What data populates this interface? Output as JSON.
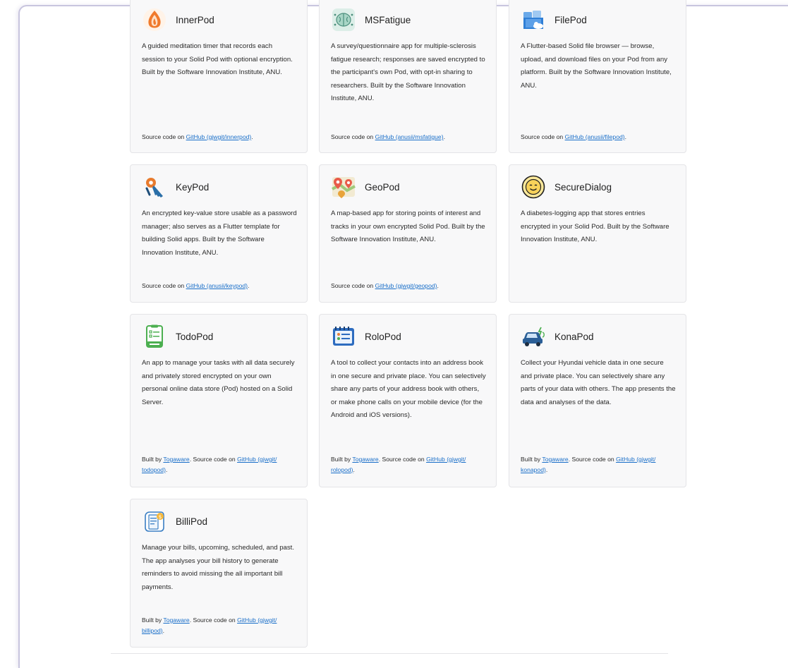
{
  "cards": [
    {
      "title": "InnerPod",
      "icon": "lotus-flame-icon",
      "desc": "A guided meditation timer that records each session to your Solid Pod with optional encryption. Built by the Software Innovation Institute, ANU.",
      "foot_pre": "Source code on ",
      "link1": "GitHub (gjwgit/innerpod)",
      "foot_post": "."
    },
    {
      "title": "MSFatigue",
      "icon": "brain-icon",
      "desc": "A survey/questionnaire app for multiple-sclerosis fatigue research; responses are saved encrypted to the participant's own Pod, with opt-in sharing to researchers. Built by the Software Innovation Institute, ANU.",
      "foot_pre": "Source code on ",
      "link1": "GitHub (anusii/msfatigue)",
      "foot_post": "."
    },
    {
      "title": "FilePod",
      "icon": "folder-cloud-icon",
      "desc": "A Flutter-based Solid file browser — browse, upload, and download files on your Pod from any platform. Built by the Software Innovation Institute, ANU.",
      "foot_pre": "Source code on ",
      "link1": "GitHub (anusii/filepod)",
      "foot_post": "."
    },
    {
      "title": "KeyPod",
      "icon": "key-icon",
      "desc": "An encrypted key-value store usable as a password manager; also serves as a Flutter template for building Solid apps. Built by the Software Innovation Institute, ANU.",
      "foot_pre": "Source code on ",
      "link1": "GitHub (anusii/keypod)",
      "foot_post": "."
    },
    {
      "title": "GeoPod",
      "icon": "map-pin-icon",
      "desc": "A map-based app for storing points of interest and tracks in your own encrypted Solid Pod. Built by the Software Innovation Institute, ANU.",
      "foot_pre": "Source code on ",
      "link1": "GitHub (gjwgit/geopod)",
      "foot_post": "."
    },
    {
      "title": "SecureDialog",
      "icon": "smiley-icon",
      "desc": "A diabetes-logging app that stores entries encrypted in your Solid Pod. Built by the Software Innovation Institute, ANU.",
      "foot_pre": "",
      "link1": "",
      "foot_post": ""
    },
    {
      "title": "TodoPod",
      "icon": "todo-list-icon",
      "desc": "An app to manage your tasks with all data securely and privately stored encrypted on your own personal online data store (Pod) hosted on a Solid Server.",
      "foot_pre": "Built by ",
      "link0": "Togaware",
      "foot_mid": ". Source code on ",
      "link1": "GitHub (gjwgit/ todopod)",
      "foot_post": "."
    },
    {
      "title": "RoloPod",
      "icon": "address-book-icon",
      "desc": "A tool to collect your contacts into an address book in one secure and private place. You can selectively share any parts of your address book with others, or make phone calls on your mobile device (for the Android and iOS versions).",
      "foot_pre": "Built by ",
      "link0": "Togaware",
      "foot_mid": ". Source code on ",
      "link1": "GitHub (gjwgit/ rolopod)",
      "foot_post": "."
    },
    {
      "title": "KonaPod",
      "icon": "electric-car-icon",
      "desc": "Collect your Hyundai vehicle data in one secure and private place. You can selectively share any parts of your data with others. The app presents the data and analyses of the data.",
      "foot_pre": "Built by ",
      "link0": "Togaware",
      "foot_mid": ". Source code on ",
      "link1": "GitHub (gjwgit/ konapod)",
      "foot_post": "."
    },
    {
      "title": "BilliPod",
      "icon": "bill-icon",
      "desc": "Manage your bills, upcoming, scheduled, and past. The app analyses your bill history to generate reminders to avoid missing the all important bill payments.",
      "foot_pre": "Built by ",
      "link0": "Togaware",
      "foot_mid": ". Source code on ",
      "link1": "GitHub (gjwgit/ billipod)",
      "foot_post": "."
    }
  ]
}
